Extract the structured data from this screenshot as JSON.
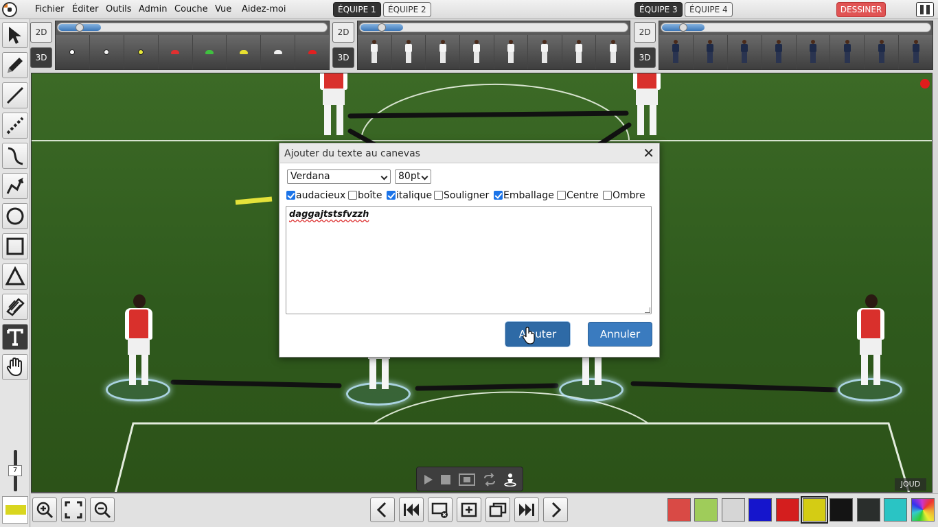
{
  "menu": {
    "items": [
      "Fichier",
      "Éditer",
      "Outils",
      "Admin",
      "Couche",
      "Vue",
      "Aidez-moi"
    ],
    "teams": [
      "ÉQUIPE 1",
      "ÉQUIPE 2",
      "ÉQUIPE 3",
      "ÉQUIPE 4"
    ],
    "active_teams": [
      "ÉQUIPE 1",
      "ÉQUIPE 3"
    ],
    "draw_label": "DESSINER"
  },
  "toolbar": {
    "tools": [
      "select-arrow",
      "pencil",
      "line",
      "dashed-line",
      "curve",
      "zigzag",
      "circle",
      "square",
      "triangle",
      "hatched-area",
      "text",
      "hand"
    ],
    "selected_tool": "text",
    "zoom_value": "7"
  },
  "palettes": {
    "mode_2d": "2D",
    "mode_3d": "3D",
    "equipment": [
      {
        "type": "ball",
        "color": "#ffffff"
      },
      {
        "type": "ball",
        "color": "#f5f5f5"
      },
      {
        "type": "ball",
        "color": "#e8e83a"
      },
      {
        "type": "cone",
        "color": "#e03030"
      },
      {
        "type": "cone",
        "color": "#40c040"
      },
      {
        "type": "cone",
        "color": "#e8e030"
      },
      {
        "type": "cone",
        "color": "#f0f0f0"
      },
      {
        "type": "cone",
        "color": "#e02020"
      }
    ],
    "team_white_count": 8,
    "team_navy_count": 8
  },
  "dialog": {
    "title": "Ajouter du texte au canevas",
    "font": "Verdana",
    "size": "80pt",
    "options": [
      {
        "label": "audacieux",
        "checked": true
      },
      {
        "label": "boîte",
        "checked": false
      },
      {
        "label": "italique",
        "checked": true
      },
      {
        "label": "Souligner",
        "checked": false
      },
      {
        "label": "Emballage",
        "checked": true
      },
      {
        "label": "Centre",
        "checked": false
      },
      {
        "label": "Ombre",
        "checked": false
      }
    ],
    "text": "daggajtstsfvzzh",
    "add_label": "Ajouter",
    "cancel_label": "Annuler"
  },
  "field": {
    "watermark": "JOUD"
  },
  "bottom": {
    "current_color": "#d9d61f",
    "colors": [
      "#d94a45",
      "#9fcc5a",
      "#d6d6d6",
      "#1515cc",
      "#d41e1e",
      "#d4cc14",
      "#141414",
      "#2a2e2c",
      "#2ac4c4",
      "rainbow"
    ],
    "selected_color": "#d4cc14"
  }
}
